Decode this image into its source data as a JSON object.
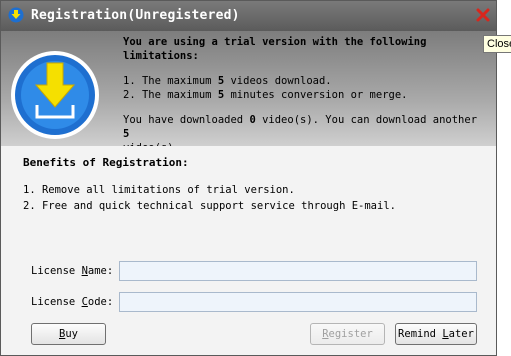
{
  "window": {
    "title": "Registration(Unregistered)",
    "tooltip": "Close"
  },
  "trial": {
    "heading_line1": "You are using a trial version with the following",
    "heading_line2": "limitations:",
    "limit1_prefix": "1. The maximum ",
    "limit1_value": "5",
    "limit1_suffix": " videos download.",
    "limit2_prefix": "2. The maximum ",
    "limit2_value": "5",
    "limit2_suffix": " minutes conversion or merge.",
    "downloaded_prefix": "You have downloaded ",
    "downloaded_value": "0",
    "downloaded_middle": " video(s). You can download another ",
    "remaining_value": "5",
    "downloaded_line2": "video(s)."
  },
  "benefits": {
    "title": "Benefits of Registration:",
    "items": [
      "1. Remove all limitations of trial version.",
      "2. Free and quick technical support service through E-mail."
    ]
  },
  "form": {
    "license_name_pre": "License ",
    "license_name_key": "N",
    "license_name_post": "ame:",
    "license_name_value": "",
    "license_code_pre": "License ",
    "license_code_key": "C",
    "license_code_post": "ode:",
    "license_code_value": ""
  },
  "buttons": {
    "buy_pre": "",
    "buy_key": "B",
    "buy_post": "uy",
    "register_pre": "",
    "register_key": "R",
    "register_post": "egister",
    "remind_pre": "Remind ",
    "remind_key": "L",
    "remind_post": "ater"
  },
  "colors": {
    "logo_ring": "#1e6fd0",
    "logo_arrow": "#f5e000",
    "close_x": "#d9261c"
  }
}
